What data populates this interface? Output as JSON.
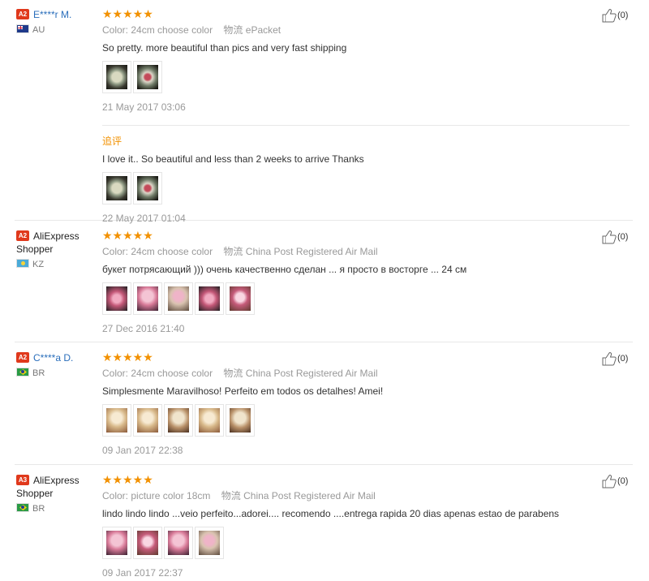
{
  "reviews": [
    {
      "badge": "A2",
      "user": "E****r M.",
      "user_link": true,
      "country": "AU",
      "flag": "au",
      "stars": "★★★★★",
      "color_label": "Color:",
      "color_value": "24cm choose color",
      "ship_label": "物流",
      "ship_value": "ePacket",
      "content": "So pretty. more beautiful than pics and very fast shipping",
      "images": [
        "dark",
        "dark r"
      ],
      "date": "21 May 2017 03:06",
      "followup": {
        "label": "追评",
        "content": "I love it.. So beautiful and less than 2 weeks to arrive Thanks",
        "images": [
          "dark",
          "dark r"
        ],
        "date": "22 May 2017 01:04"
      },
      "likes": "(0)"
    },
    {
      "badge": "A2",
      "user": "AliExpress Shopper",
      "user_link": false,
      "country": "KZ",
      "flag": "kz",
      "stars": "★★★★★",
      "color_label": "Color:",
      "color_value": "24cm choose color",
      "ship_label": "物流",
      "ship_value": "China Post Registered Air Mail",
      "content": "букет потрясающий ))) очень качественно сделан ... я просто в восторге ... 24 см",
      "images": [
        "pink3",
        "pink",
        "mixed",
        "pink3",
        "pink2"
      ],
      "date": "27 Dec 2016 21:40",
      "likes": "(0)"
    },
    {
      "badge": "A2",
      "user": "C****a D.",
      "user_link": true,
      "country": "BR",
      "flag": "br",
      "stars": "★★★★★",
      "color_label": "Color:",
      "color_value": "24cm choose color",
      "ship_label": "物流",
      "ship_value": "China Post Registered Air Mail",
      "content": "Simplesmente Maravilhoso! Perfeito em todos os detalhes! Amei!",
      "images": [
        "cream",
        "cream",
        "cream2",
        "cream",
        "cream2"
      ],
      "date": "09 Jan 2017 22:38",
      "likes": "(0)"
    },
    {
      "badge": "A3",
      "user": "AliExpress Shopper",
      "user_link": false,
      "country": "BR",
      "flag": "br",
      "stars": "★★★★★",
      "color_label": "Color:",
      "color_value": "picture color 18cm",
      "ship_label": "物流",
      "ship_value": "China Post Registered Air Mail",
      "content": "lindo lindo lindo ...veio perfeito...adorei.... recomendo ....entrega rapida 20 dias apenas estao de parabens",
      "images": [
        "pink",
        "pink2",
        "pink",
        "mixed"
      ],
      "date": "09 Jan 2017 22:37",
      "likes": "(0)"
    }
  ],
  "icons": {
    "like": "thumbs-up-icon"
  }
}
